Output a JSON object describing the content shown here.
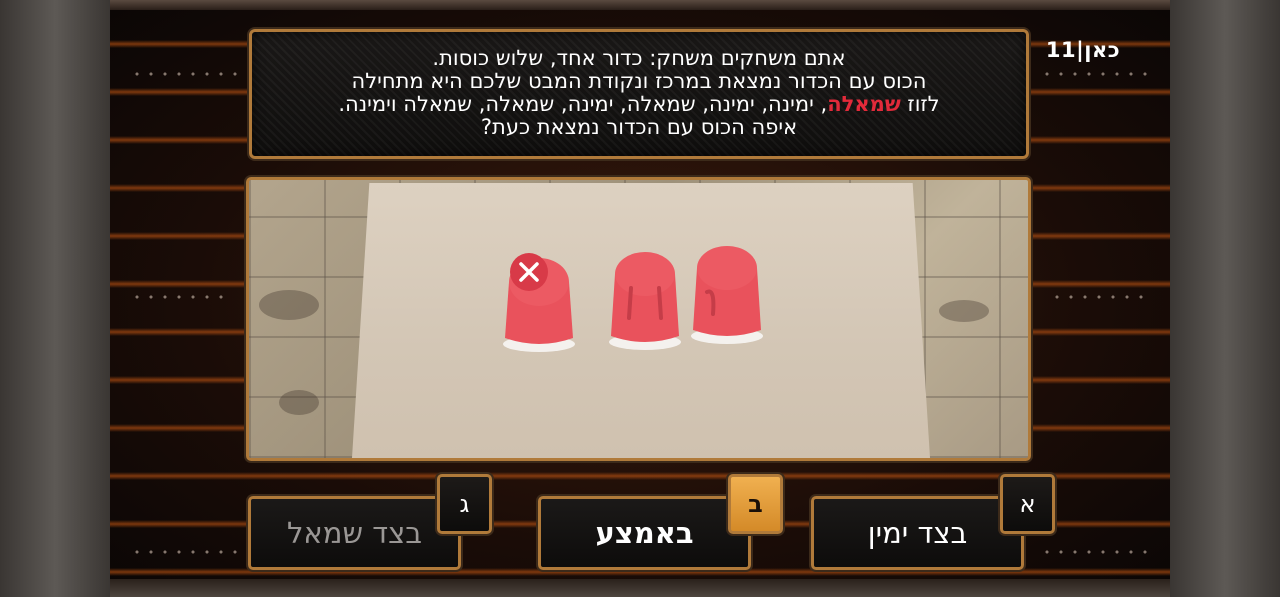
{
  "channel_logo": "כאן|11",
  "question": {
    "line1": "אתם משחקים משחק: כדור אחד, שלוש כוסות.",
    "line2": "הכוס עם הכדור נמצאת במרכז ונקודת המבט שלכם היא מתחילה",
    "line3_prefix": "לזוז ",
    "line3_highlight": "שמאלה",
    "line3_rest": ", ימינה, ימינה, שמאלה, ימינה, שמאלה, שמאלה וימינה.",
    "line4": "איפה הכוס עם הכדור נמצאת כעת?"
  },
  "scene": {
    "cups": 3,
    "marked_cup": "left",
    "cup_color": "#e9525c",
    "mark_icon": "x-icon"
  },
  "answers": [
    {
      "letter": "א",
      "label": "בצד ימין",
      "selected": false
    },
    {
      "letter": "ב",
      "label": "באמצע",
      "selected": true
    },
    {
      "letter": "ג",
      "label": "בצד שמאל",
      "selected": false
    }
  ],
  "colors": {
    "frame": "#b07a3a",
    "highlight": "#e22a3a",
    "selected_letter": "#e8a440"
  }
}
